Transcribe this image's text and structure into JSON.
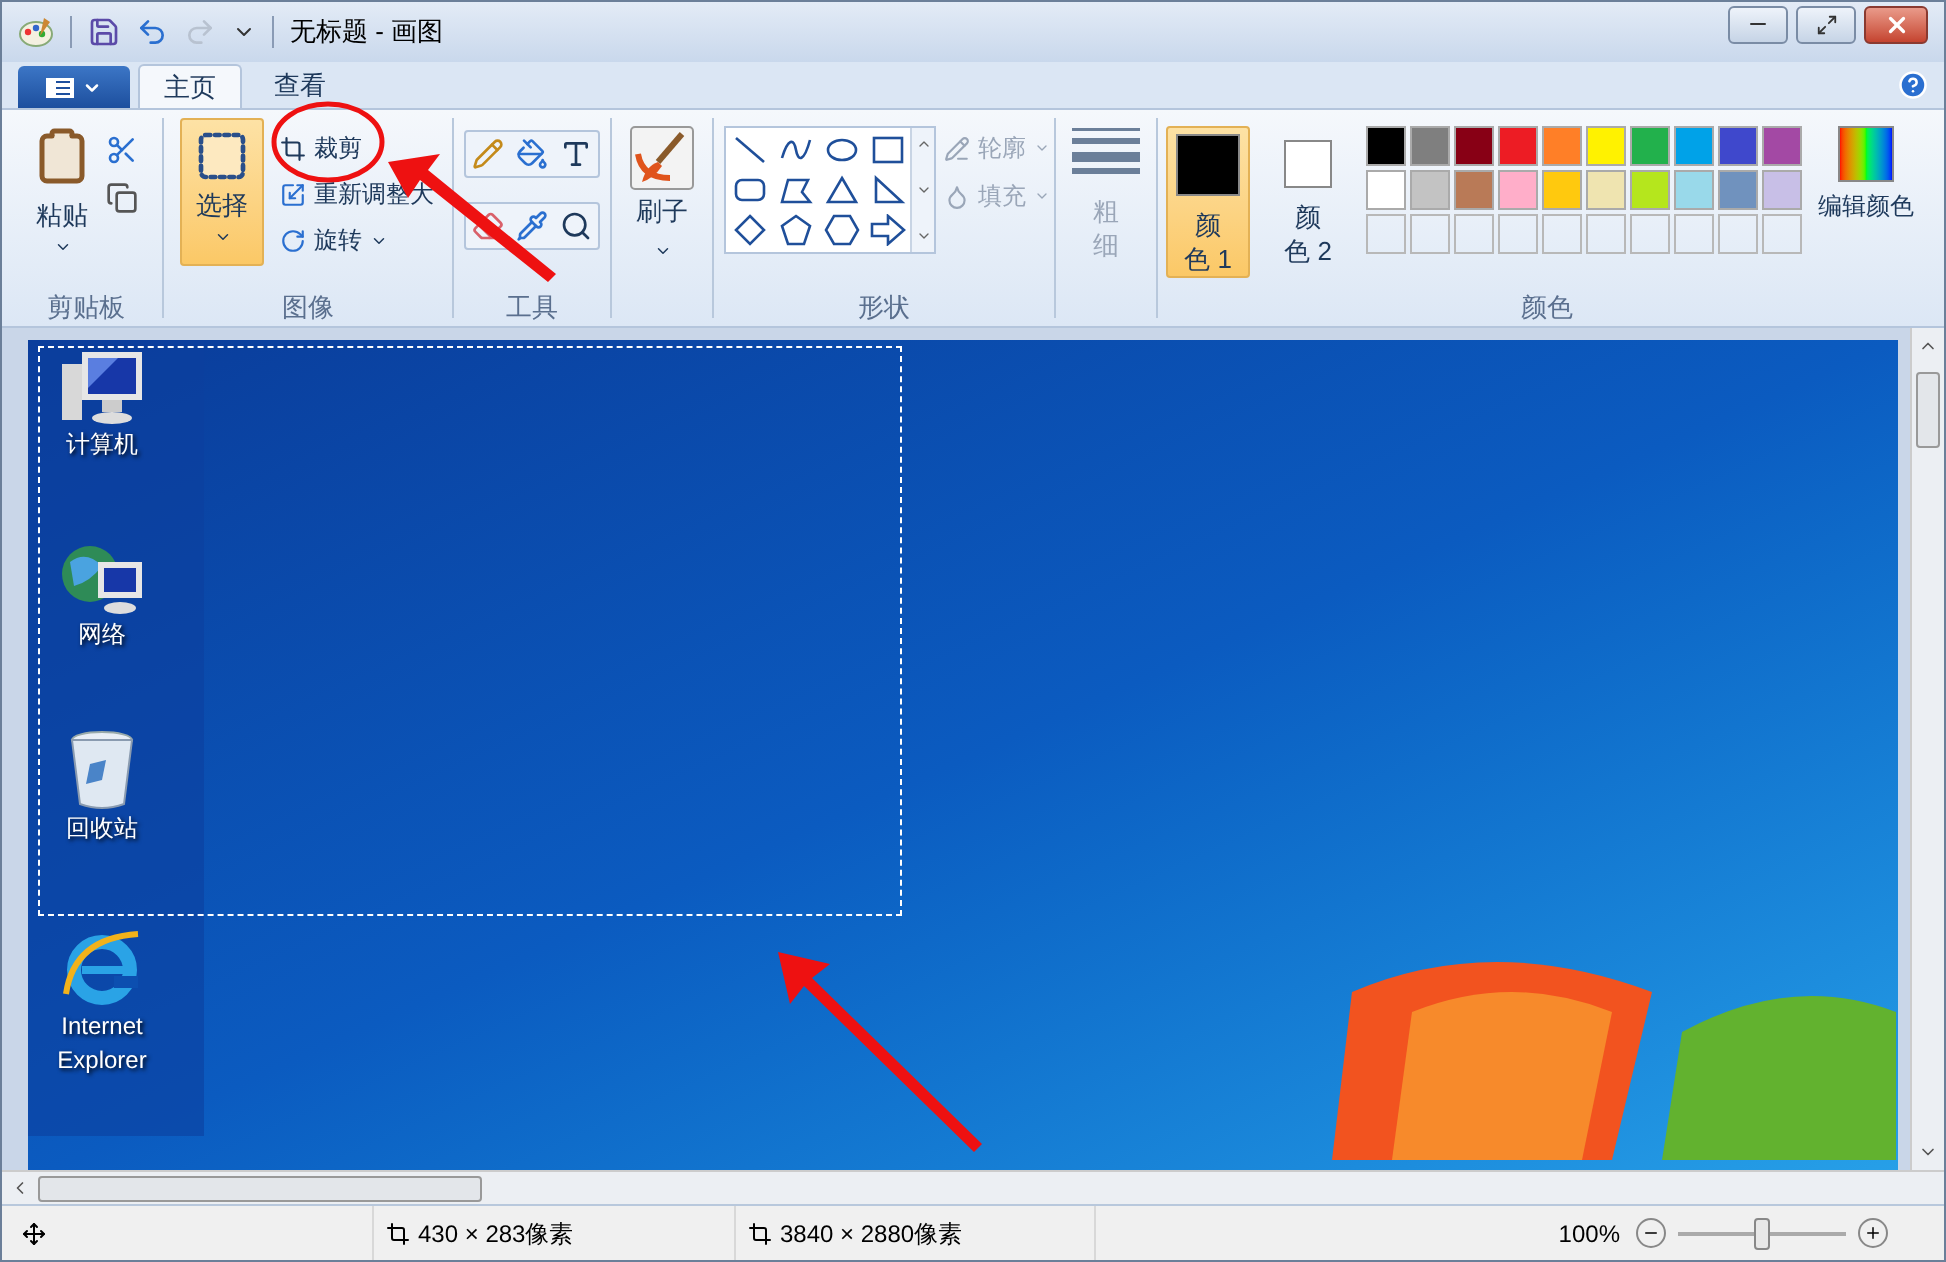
{
  "window": {
    "title": "无标题 - 画图"
  },
  "ribbon_tabs": [
    {
      "label": "主页",
      "selected": true
    },
    {
      "label": "查看",
      "selected": false
    }
  ],
  "clipboard": {
    "label": "剪贴板",
    "paste": "粘贴"
  },
  "image": {
    "label": "图像",
    "select": "选择",
    "select_selected": true,
    "crop": "裁剪",
    "resize": "重新调整大",
    "rotate": "旋转"
  },
  "tools": {
    "label": "工具"
  },
  "brushes": {
    "label": "刷子"
  },
  "shapes": {
    "label": "形状",
    "outline": "轮廓",
    "fill": "填充",
    "disabled": true
  },
  "size": {
    "label": "粗细",
    "disabled": true
  },
  "colors": {
    "label": "颜色",
    "edit": "编辑颜色",
    "slots": [
      {
        "label": "颜色 1",
        "selected": true,
        "color": "#000000"
      },
      {
        "label": "颜色 2",
        "selected": false,
        "color": "#ffffff"
      }
    ],
    "palette": [
      {
        "color": "#000000"
      },
      {
        "color": "#7f7f7f"
      },
      {
        "color": "#880015"
      },
      {
        "color": "#ed1c24"
      },
      {
        "color": "#ff7f27"
      },
      {
        "color": "#fff200"
      },
      {
        "color": "#22b14c"
      },
      {
        "color": "#00a2e8"
      },
      {
        "color": "#3f48cc"
      },
      {
        "color": "#a349a4"
      },
      {
        "color": "#ffffff"
      },
      {
        "color": "#c3c3c3"
      },
      {
        "color": "#b97a57"
      },
      {
        "color": "#ffaec9"
      },
      {
        "color": "#ffc90e"
      },
      {
        "color": "#efe4b0"
      },
      {
        "color": "#b5e61d"
      },
      {
        "color": "#99d9ea"
      },
      {
        "color": "#7092be"
      },
      {
        "color": "#c8bfe7"
      }
    ]
  },
  "desktop_icons": [
    {
      "kind": "computer",
      "label": "计算机"
    },
    {
      "kind": "network",
      "label": "网络"
    },
    {
      "kind": "recycle",
      "label": "回收站"
    },
    {
      "kind": "browser",
      "label": "Internet\nExplorer"
    }
  ],
  "status_bar": {
    "selection": "430 × 283像素",
    "image_size": "3840 × 2880像素",
    "zoom": "100%",
    "zoom_slider": {
      "level": 0.5
    }
  }
}
